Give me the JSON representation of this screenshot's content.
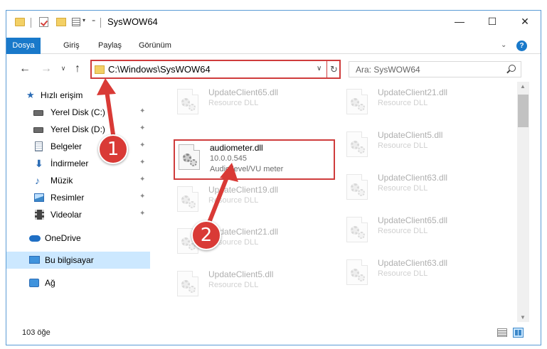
{
  "window": {
    "title": "SysWOW64",
    "controls": {
      "minimize": "—",
      "maximize": "☐",
      "close": "✕"
    }
  },
  "quick_access_toolbar": {
    "icons": [
      "folder-icon",
      "checkmark-properties-icon",
      "new-folder-icon",
      "properties-icon"
    ],
    "dropdown": "▾",
    "customize": "₌"
  },
  "ribbon": {
    "tabs": [
      "Dosya",
      "Giriş",
      "Paylaş",
      "Görünüm"
    ],
    "active_tab": "Dosya",
    "expand": "⌄",
    "help": "?"
  },
  "address_bar": {
    "back": "←",
    "forward": "→",
    "recent": "∨",
    "up": "↑",
    "path": "C:\\Windows\\SysWOW64",
    "dropdown": "∨",
    "refresh": "↻",
    "search_placeholder": "Ara: SysWOW64"
  },
  "sidebar": {
    "items": [
      {
        "label": "Hızlı erişim",
        "icon": "star-icon"
      },
      {
        "label": "Yerel Disk (C:)",
        "icon": "drive-icon",
        "pinned": true
      },
      {
        "label": "Yerel Disk (D:)",
        "icon": "drive-icon",
        "pinned": true
      },
      {
        "label": "Belgeler",
        "icon": "documents-icon",
        "pinned": true
      },
      {
        "label": "İndirmeler",
        "icon": "downloads-icon",
        "pinned": true
      },
      {
        "label": "Müzik",
        "icon": "music-icon",
        "pinned": true
      },
      {
        "label": "Resimler",
        "icon": "pictures-icon",
        "pinned": true
      },
      {
        "label": "Videolar",
        "icon": "videos-icon",
        "pinned": true
      },
      {
        "label": "OneDrive",
        "icon": "onedrive-icon"
      },
      {
        "label": "Bu bilgisayar",
        "icon": "this-pc-icon",
        "selected": true
      },
      {
        "label": "Ağ",
        "icon": "network-icon"
      }
    ],
    "pin_glyph": "📌"
  },
  "files": {
    "left_column": [
      {
        "name": "UpdateClient65.dll",
        "desc": "Resource DLL"
      },
      {
        "name": "audiometer.dll",
        "version": "10.0.0.545",
        "desc": "Audio level/VU meter",
        "highlighted": true
      },
      {
        "name": "UpdateClient19.dll",
        "desc": "Resource DLL"
      },
      {
        "name": "UpdateClient21.dll",
        "desc": "Resource DLL"
      },
      {
        "name": "UpdateClient5.dll",
        "desc": "Resource DLL"
      }
    ],
    "right_column": [
      {
        "name": "UpdateClient21.dll",
        "desc": "Resource DLL"
      },
      {
        "name": "UpdateClient5.dll",
        "desc": "Resource DLL"
      },
      {
        "name": "UpdateClient63.dll",
        "desc": "Resource DLL"
      },
      {
        "name": "UpdateClient65.dll",
        "desc": "Resource DLL"
      },
      {
        "name": "UpdateClient63.dll",
        "desc": "Resource DLL"
      }
    ]
  },
  "scrollbar": {
    "up": "▲",
    "down": "▼"
  },
  "status_bar": {
    "item_count": "103 öğe"
  },
  "callouts": {
    "step1": "1",
    "step2": "2",
    "color": "#d93a36"
  }
}
